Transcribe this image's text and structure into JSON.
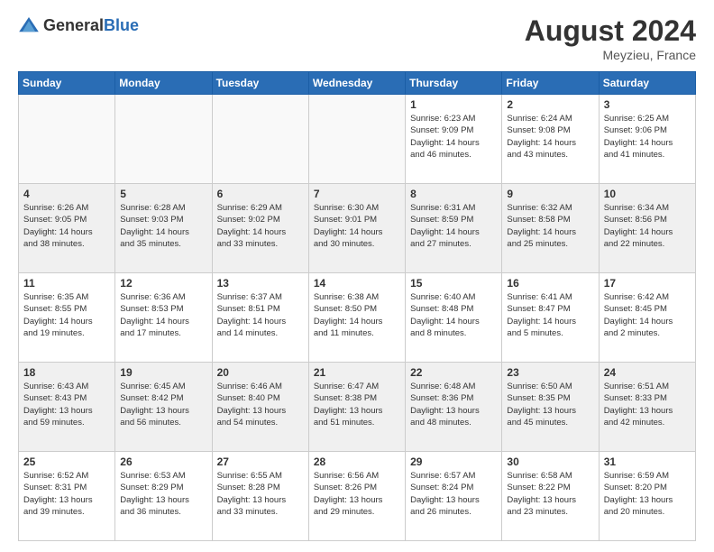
{
  "header": {
    "logo_general": "General",
    "logo_blue": "Blue",
    "month_year": "August 2024",
    "location": "Meyzieu, France"
  },
  "calendar": {
    "days_of_week": [
      "Sunday",
      "Monday",
      "Tuesday",
      "Wednesday",
      "Thursday",
      "Friday",
      "Saturday"
    ],
    "weeks": [
      [
        {
          "day": "",
          "info": "",
          "empty": true
        },
        {
          "day": "",
          "info": "",
          "empty": true
        },
        {
          "day": "",
          "info": "",
          "empty": true
        },
        {
          "day": "",
          "info": "",
          "empty": true
        },
        {
          "day": "1",
          "info": "Sunrise: 6:23 AM\nSunset: 9:09 PM\nDaylight: 14 hours\nand 46 minutes.",
          "empty": false
        },
        {
          "day": "2",
          "info": "Sunrise: 6:24 AM\nSunset: 9:08 PM\nDaylight: 14 hours\nand 43 minutes.",
          "empty": false
        },
        {
          "day": "3",
          "info": "Sunrise: 6:25 AM\nSunset: 9:06 PM\nDaylight: 14 hours\nand 41 minutes.",
          "empty": false
        }
      ],
      [
        {
          "day": "4",
          "info": "Sunrise: 6:26 AM\nSunset: 9:05 PM\nDaylight: 14 hours\nand 38 minutes.",
          "empty": false
        },
        {
          "day": "5",
          "info": "Sunrise: 6:28 AM\nSunset: 9:03 PM\nDaylight: 14 hours\nand 35 minutes.",
          "empty": false
        },
        {
          "day": "6",
          "info": "Sunrise: 6:29 AM\nSunset: 9:02 PM\nDaylight: 14 hours\nand 33 minutes.",
          "empty": false
        },
        {
          "day": "7",
          "info": "Sunrise: 6:30 AM\nSunset: 9:01 PM\nDaylight: 14 hours\nand 30 minutes.",
          "empty": false
        },
        {
          "day": "8",
          "info": "Sunrise: 6:31 AM\nSunset: 8:59 PM\nDaylight: 14 hours\nand 27 minutes.",
          "empty": false
        },
        {
          "day": "9",
          "info": "Sunrise: 6:32 AM\nSunset: 8:58 PM\nDaylight: 14 hours\nand 25 minutes.",
          "empty": false
        },
        {
          "day": "10",
          "info": "Sunrise: 6:34 AM\nSunset: 8:56 PM\nDaylight: 14 hours\nand 22 minutes.",
          "empty": false
        }
      ],
      [
        {
          "day": "11",
          "info": "Sunrise: 6:35 AM\nSunset: 8:55 PM\nDaylight: 14 hours\nand 19 minutes.",
          "empty": false
        },
        {
          "day": "12",
          "info": "Sunrise: 6:36 AM\nSunset: 8:53 PM\nDaylight: 14 hours\nand 17 minutes.",
          "empty": false
        },
        {
          "day": "13",
          "info": "Sunrise: 6:37 AM\nSunset: 8:51 PM\nDaylight: 14 hours\nand 14 minutes.",
          "empty": false
        },
        {
          "day": "14",
          "info": "Sunrise: 6:38 AM\nSunset: 8:50 PM\nDaylight: 14 hours\nand 11 minutes.",
          "empty": false
        },
        {
          "day": "15",
          "info": "Sunrise: 6:40 AM\nSunset: 8:48 PM\nDaylight: 14 hours\nand 8 minutes.",
          "empty": false
        },
        {
          "day": "16",
          "info": "Sunrise: 6:41 AM\nSunset: 8:47 PM\nDaylight: 14 hours\nand 5 minutes.",
          "empty": false
        },
        {
          "day": "17",
          "info": "Sunrise: 6:42 AM\nSunset: 8:45 PM\nDaylight: 14 hours\nand 2 minutes.",
          "empty": false
        }
      ],
      [
        {
          "day": "18",
          "info": "Sunrise: 6:43 AM\nSunset: 8:43 PM\nDaylight: 13 hours\nand 59 minutes.",
          "empty": false
        },
        {
          "day": "19",
          "info": "Sunrise: 6:45 AM\nSunset: 8:42 PM\nDaylight: 13 hours\nand 56 minutes.",
          "empty": false
        },
        {
          "day": "20",
          "info": "Sunrise: 6:46 AM\nSunset: 8:40 PM\nDaylight: 13 hours\nand 54 minutes.",
          "empty": false
        },
        {
          "day": "21",
          "info": "Sunrise: 6:47 AM\nSunset: 8:38 PM\nDaylight: 13 hours\nand 51 minutes.",
          "empty": false
        },
        {
          "day": "22",
          "info": "Sunrise: 6:48 AM\nSunset: 8:36 PM\nDaylight: 13 hours\nand 48 minutes.",
          "empty": false
        },
        {
          "day": "23",
          "info": "Sunrise: 6:50 AM\nSunset: 8:35 PM\nDaylight: 13 hours\nand 45 minutes.",
          "empty": false
        },
        {
          "day": "24",
          "info": "Sunrise: 6:51 AM\nSunset: 8:33 PM\nDaylight: 13 hours\nand 42 minutes.",
          "empty": false
        }
      ],
      [
        {
          "day": "25",
          "info": "Sunrise: 6:52 AM\nSunset: 8:31 PM\nDaylight: 13 hours\nand 39 minutes.",
          "empty": false
        },
        {
          "day": "26",
          "info": "Sunrise: 6:53 AM\nSunset: 8:29 PM\nDaylight: 13 hours\nand 36 minutes.",
          "empty": false
        },
        {
          "day": "27",
          "info": "Sunrise: 6:55 AM\nSunset: 8:28 PM\nDaylight: 13 hours\nand 33 minutes.",
          "empty": false
        },
        {
          "day": "28",
          "info": "Sunrise: 6:56 AM\nSunset: 8:26 PM\nDaylight: 13 hours\nand 29 minutes.",
          "empty": false
        },
        {
          "day": "29",
          "info": "Sunrise: 6:57 AM\nSunset: 8:24 PM\nDaylight: 13 hours\nand 26 minutes.",
          "empty": false
        },
        {
          "day": "30",
          "info": "Sunrise: 6:58 AM\nSunset: 8:22 PM\nDaylight: 13 hours\nand 23 minutes.",
          "empty": false
        },
        {
          "day": "31",
          "info": "Sunrise: 6:59 AM\nSunset: 8:20 PM\nDaylight: 13 hours\nand 20 minutes.",
          "empty": false
        }
      ]
    ]
  }
}
